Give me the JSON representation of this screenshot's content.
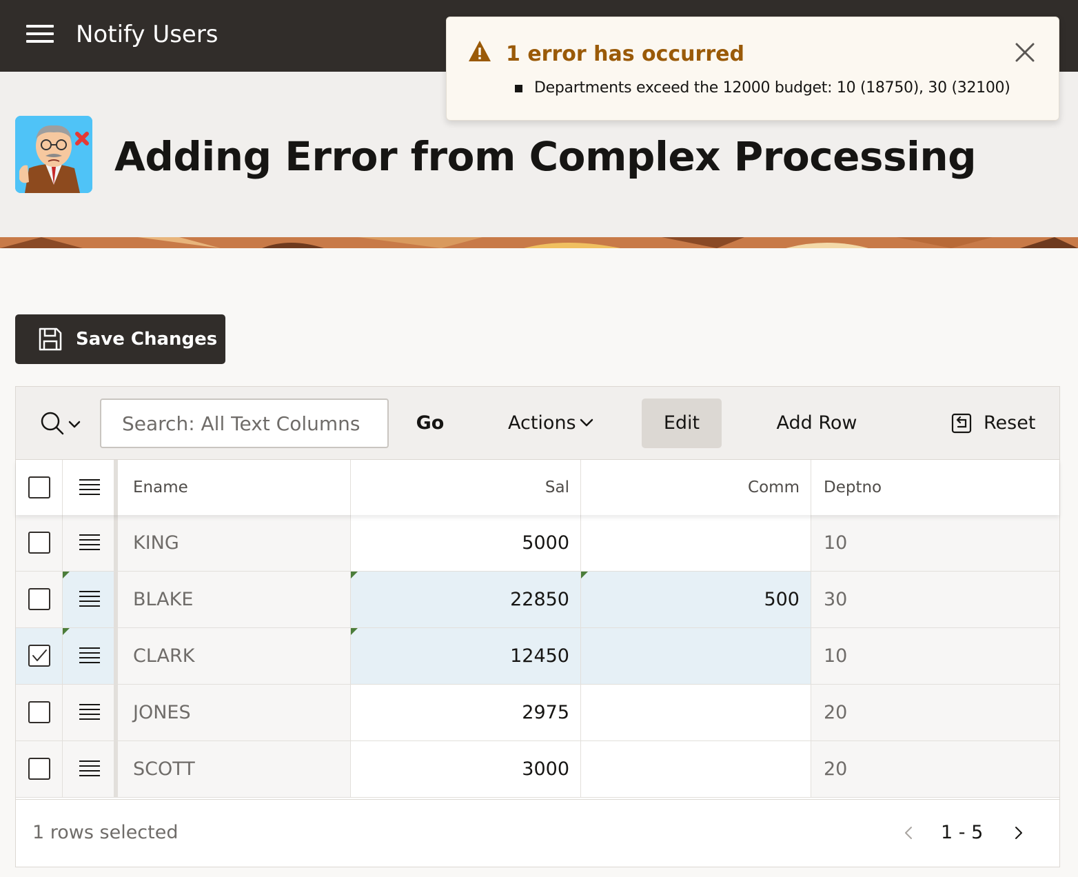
{
  "header": {
    "app_title": "Notify Users"
  },
  "page": {
    "title": "Adding Error from Complex Processing"
  },
  "alert": {
    "title": "1 error has occurred",
    "messages": [
      "Departments exceed the 12000 budget: 10 (18750), 30 (32100)"
    ]
  },
  "buttons": {
    "save_label": "Save Changes"
  },
  "toolbar": {
    "search_placeholder": "Search: All Text Columns",
    "go_label": "Go",
    "actions_label": "Actions",
    "edit_label": "Edit",
    "add_row_label": "Add Row",
    "reset_label": "Reset"
  },
  "grid": {
    "columns": [
      "Ename",
      "Sal",
      "Comm",
      "Deptno"
    ],
    "rows": [
      {
        "ename": "KING",
        "sal": "5000",
        "comm": "",
        "deptno": "10",
        "selected": false
      },
      {
        "ename": "BLAKE",
        "sal": "22850",
        "comm": "500",
        "deptno": "30",
        "selected": false
      },
      {
        "ename": "CLARK",
        "sal": "12450",
        "comm": "",
        "deptno": "10",
        "selected": true
      },
      {
        "ename": "JONES",
        "sal": "2975",
        "comm": "",
        "deptno": "20",
        "selected": false
      },
      {
        "ename": "SCOTT",
        "sal": "3000",
        "comm": "",
        "deptno": "20",
        "selected": false
      }
    ]
  },
  "footer": {
    "status": "1 rows selected",
    "range": "1 - 5"
  },
  "colors": {
    "header_bg": "#312d2a",
    "alert_title": "#9a5a08",
    "changed_cell": "#e6f0f6",
    "change_flag": "#4b7d3a"
  }
}
